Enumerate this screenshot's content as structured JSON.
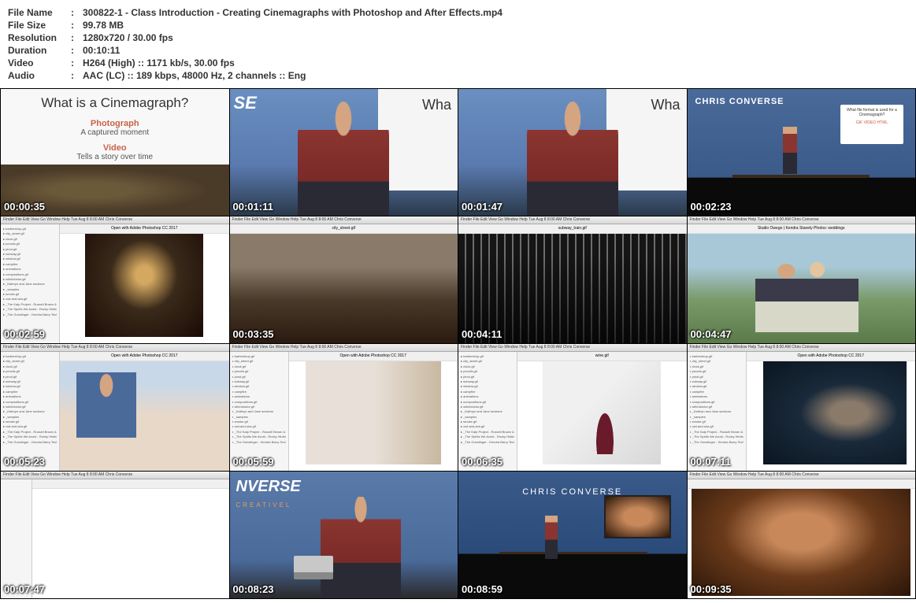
{
  "info": {
    "file_name_label": "File Name",
    "file_name": "300822-1 - Class Introduction - Creating Cinemagraphs with Photoshop and After Effects.mp4",
    "file_size_label": "File Size",
    "file_size": "99.78 MB",
    "resolution_label": "Resolution",
    "resolution": "1280x720 / 30.00 fps",
    "duration_label": "Duration",
    "duration": "00:10:11",
    "video_label": "Video",
    "video": "H264 (High) :: 1171 kb/s, 30.00 fps",
    "audio_label": "Audio",
    "audio": "AAC (LC) :: 189 kbps, 48000 Hz, 2 channels :: Eng"
  },
  "thumbnails": [
    {
      "ts": "00:00:35",
      "slide_title": "What is a Cinemagraph?",
      "sub1a": "Photograph",
      "sub1b": "A captured moment",
      "sub2a": "Video",
      "sub2b": "Tells a story over time"
    },
    {
      "ts": "00:01:11",
      "corner": "Wha",
      "logo": "SE"
    },
    {
      "ts": "00:01:47",
      "corner": "Wha"
    },
    {
      "ts": "00:02:23",
      "name": "CHRIS CONVERSE",
      "screen_q": "What file format is used for a Cinemagraph?",
      "opts": "GIF   VIDEO   HTML"
    },
    {
      "ts": "00:02:59",
      "toolbar": "Open with Adobe Photoshop CC 2017"
    },
    {
      "ts": "00:03:35",
      "toolbar": "city_street.gif"
    },
    {
      "ts": "00:04:11",
      "toolbar": "subway_train.gif"
    },
    {
      "ts": "00:04:47",
      "toolbar": "Studio Owego | Kendra Stanely Photos: weddings"
    },
    {
      "ts": "00:05:23",
      "toolbar": "Open with Adobe Photoshop CC 2017"
    },
    {
      "ts": "00:05:59",
      "toolbar": "Open with Adobe Photoshop CC 2017"
    },
    {
      "ts": "00:06:35",
      "toolbar": "wine.gif"
    },
    {
      "ts": "00:07:11",
      "toolbar": "Open with Adobe Photoshop CC 2017"
    },
    {
      "ts": "00:07:47",
      "toolbar": ""
    },
    {
      "ts": "00:08:23",
      "logo": "NVERSE",
      "sublogo": "CREATIVEL"
    },
    {
      "ts": "00:08:59",
      "name": "CHRIS CONVERSE"
    },
    {
      "ts": "00:09:35",
      "toolbar": ""
    }
  ],
  "sidebar_files": [
    "barbershop.gif",
    "city_street.gif",
    "clock.gif",
    "pencils.gif",
    "pinot.gif",
    "subway.gif",
    "window.gif",
    "campfire",
    "animations",
    "compositions.gif",
    "witchdoctor.gif",
    "_Kathryn and Jane sections",
    "_samples",
    "smoke.gif",
    "owl-and-sea.gif",
    "_The Kalp Project - Russell Brown & Adobe MAX.webloc",
    "_The Spirits We Avoid - Rocky Hinting.webloc",
    "_The Gunslinger - Kendra Barry Tech.webloc"
  ],
  "menubar": "Finder  File  Edit  View  Go  Window  Help        Tue Aug 8  8:00 AM   Chris Converse"
}
